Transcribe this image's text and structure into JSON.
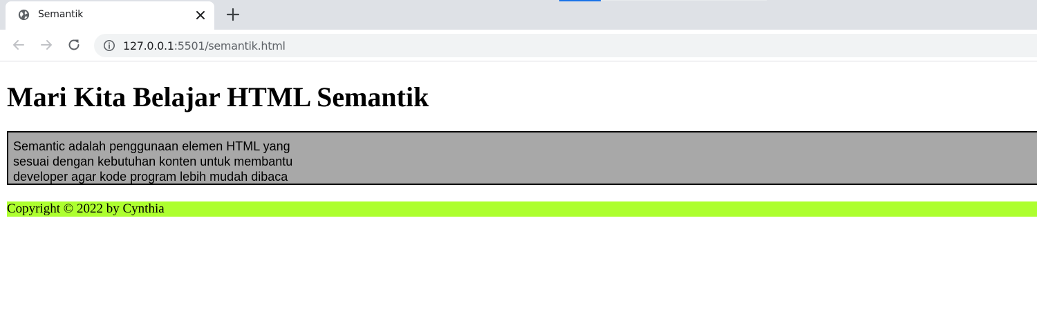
{
  "browser": {
    "tab": {
      "title": "Semantik",
      "icon": "globe-icon"
    },
    "new_tab_icon": "plus-icon",
    "nav": {
      "back_icon": "arrow-left-icon",
      "forward_icon": "arrow-right-icon",
      "reload_icon": "reload-icon"
    },
    "address_bar": {
      "host": "127.0.0.1",
      "rest": ":5501/semantik.html",
      "icon": "info-icon"
    },
    "colors": {
      "tabstrip": "#dee1e6",
      "accent": "#1a73e8"
    }
  },
  "page": {
    "heading": "Mari Kita Belajar HTML Semantik",
    "article_text": "Semantic adalah penggunaan elemen HTML yang sesuai dengan kebutuhan konten untuk membantu developer agar kode program lebih mudah dibaca",
    "footer_text": "Copyright © 2022 by Cynthia",
    "colors": {
      "article_bg": "#a8a8a8",
      "footer_bg": "#adff2f"
    }
  }
}
